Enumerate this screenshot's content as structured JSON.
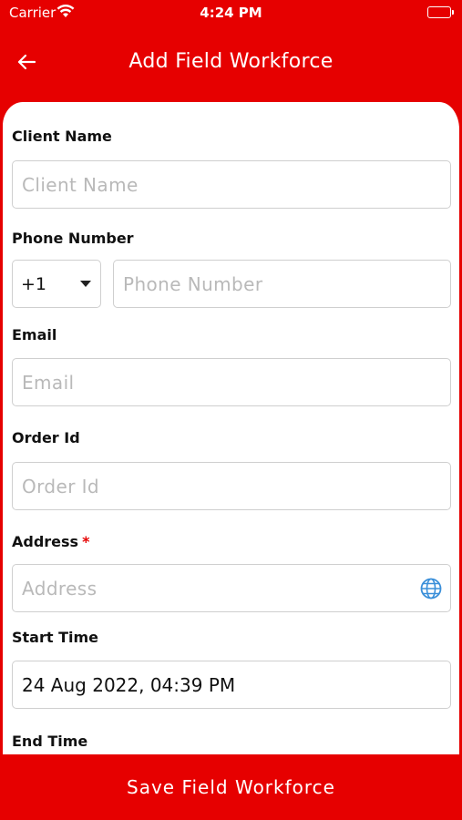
{
  "status_bar": {
    "carrier": "Carrier",
    "time": "4:24 PM"
  },
  "app_bar": {
    "title": "Add Field Workforce",
    "back_icon": "arrow-left-icon"
  },
  "form": {
    "client_name": {
      "label": "Client Name",
      "placeholder": "Client Name",
      "value": ""
    },
    "phone": {
      "label": "Phone Number",
      "country_code": "+1",
      "placeholder": "Phone Number",
      "value": ""
    },
    "email": {
      "label": "Email",
      "placeholder": "Email",
      "value": ""
    },
    "order_id": {
      "label": "Order Id",
      "placeholder": "Order Id",
      "value": ""
    },
    "address": {
      "label": "Address",
      "required_marker": "*",
      "placeholder": "Address",
      "value": "",
      "icon": "globe-icon"
    },
    "start_time": {
      "label": "Start Time",
      "value": "24 Aug 2022, 04:39 PM"
    },
    "end_time": {
      "label": "End Time"
    }
  },
  "footer": {
    "save_label": "Save Field Workforce"
  },
  "colors": {
    "brand": "#e60000",
    "globe": "#3a8fd9"
  }
}
